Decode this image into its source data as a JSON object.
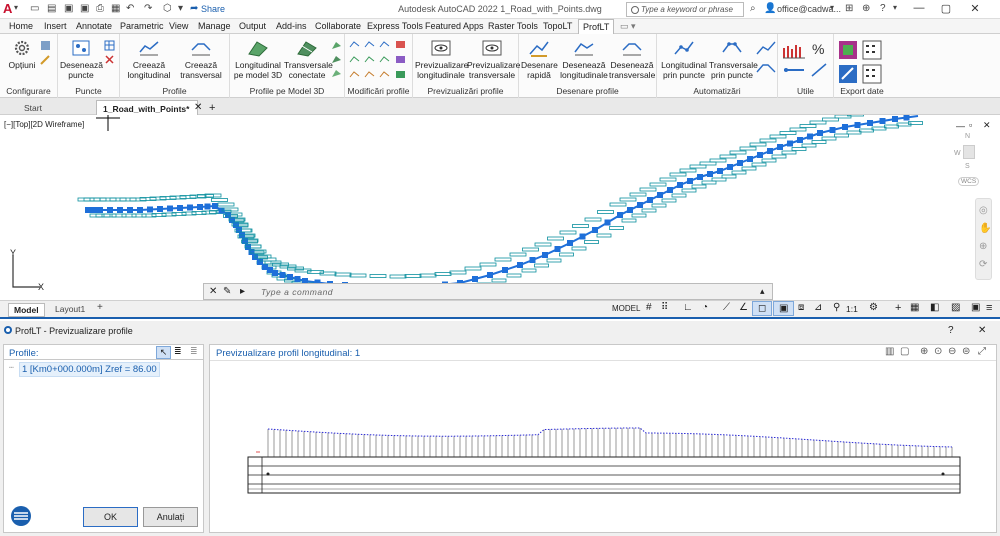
{
  "window": {
    "title": "Autodesk AutoCAD 2022   1_Road_with_Points.dwg",
    "share_label": "Share",
    "search_placeholder": "Type a keyword or phrase",
    "user": "office@cadwa..."
  },
  "menu_tabs": [
    "Home",
    "Insert",
    "Annotate",
    "Parametric",
    "View",
    "Manage",
    "Output",
    "Add-ins",
    "Collaborate",
    "Express Tools",
    "Featured Apps",
    "Raster Tools",
    "TopoLT",
    "ProfLT"
  ],
  "active_tab": "ProfLT",
  "ribbon": {
    "panels": {
      "configurare": "Configurare",
      "puncte": "Puncte",
      "profile": "Profile",
      "profile_model": "Profile pe Model 3D",
      "modificari": "Modificări profile",
      "previzualizari": "Previzualizări profile",
      "desenare": "Desenare profile",
      "automatizari": "Automatizări",
      "utile": "Utile",
      "export": "Export date"
    },
    "buttons": {
      "optiuni": "Opțiuni",
      "deseneaza_puncte_1": "Desenează",
      "deseneaza_puncte_2": "puncte",
      "creeaza_long_1": "Creează",
      "creeaza_long_2": "longitudinal",
      "creeaza_trans_1": "Creează",
      "creeaza_trans_2": "transversal",
      "long_model_1": "Longitudinal",
      "long_model_2": "pe model 3D",
      "trans_conectate_1": "Transversale",
      "trans_conectate_2": "conectate",
      "prev_long_1": "Previzualizare",
      "prev_long_2": "longitudinale",
      "prev_trans_1": "Previzualizare",
      "prev_trans_2": "transversale",
      "desenare_rapida_1": "Desenare",
      "desenare_rapida_2": "rapidă",
      "des_long_1": "Desenează",
      "des_long_2": "longitudinale",
      "des_trans_1": "Desenează",
      "des_trans_2": "transversale",
      "long_prin_1": "Longitudinal",
      "long_prin_2": "prin puncte",
      "trans_prin_1": "Transversale",
      "trans_prin_2": "prin puncte"
    }
  },
  "doc_tabs": {
    "start": "Start",
    "active": "1_Road_with_Points*",
    "add": "+"
  },
  "viewport_label": "[−][Top][2D Wireframe]",
  "viewcube": {
    "n": "N",
    "w": "W",
    "s": "S",
    "wcs": "WCS"
  },
  "ucs": {
    "y": "Y",
    "x": "X"
  },
  "command_placeholder": "Type a command",
  "layout_tabs": {
    "model": "Model",
    "layout1": "Layout1",
    "add": "+"
  },
  "status": {
    "model": "MODEL",
    "scale": "1:1"
  },
  "dialog": {
    "title": "ProfLT - Previzualizare profile",
    "help": "?",
    "profiles_label": "Profile:",
    "profile_item": "1 [Km0+000.000m] Zref = 86.00",
    "preview_title": "Previzualizare profil longitudinal: 1",
    "ok": "OK",
    "cancel": "Anulați"
  },
  "colors": {
    "accent": "#1a5fae",
    "label_teal": "#0a8f9e",
    "point_blue": "#1e6fd9",
    "profile_blue": "#2b2bd6"
  }
}
